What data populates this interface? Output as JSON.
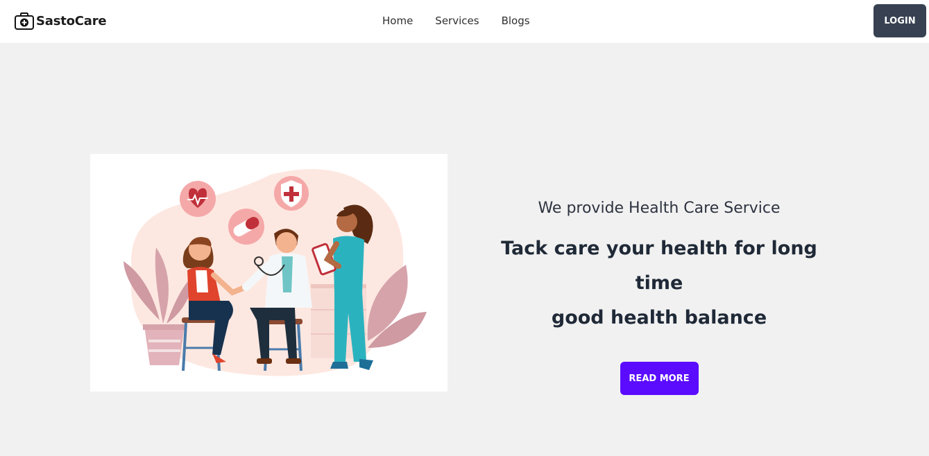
{
  "navbar": {
    "brand_name": "SastoCare",
    "brand_icon": "medical-bag-icon",
    "links": [
      "Home",
      "Services",
      "Blogs"
    ],
    "login_label": "LOGIN"
  },
  "hero": {
    "image_alt": "Doctor checking patient blood pressure with nurse",
    "tagline": "We provide Health Care Service",
    "headline_line1": "Tack care your health for long time",
    "headline_line2": "good health balance",
    "cta_label": "READ MORE"
  },
  "colors": {
    "page_background": "#f1f1f1",
    "navbar_background": "#ffffff",
    "login_button": "#374151",
    "cta_button": "#5b0cff",
    "heading_text": "#1f2937"
  }
}
